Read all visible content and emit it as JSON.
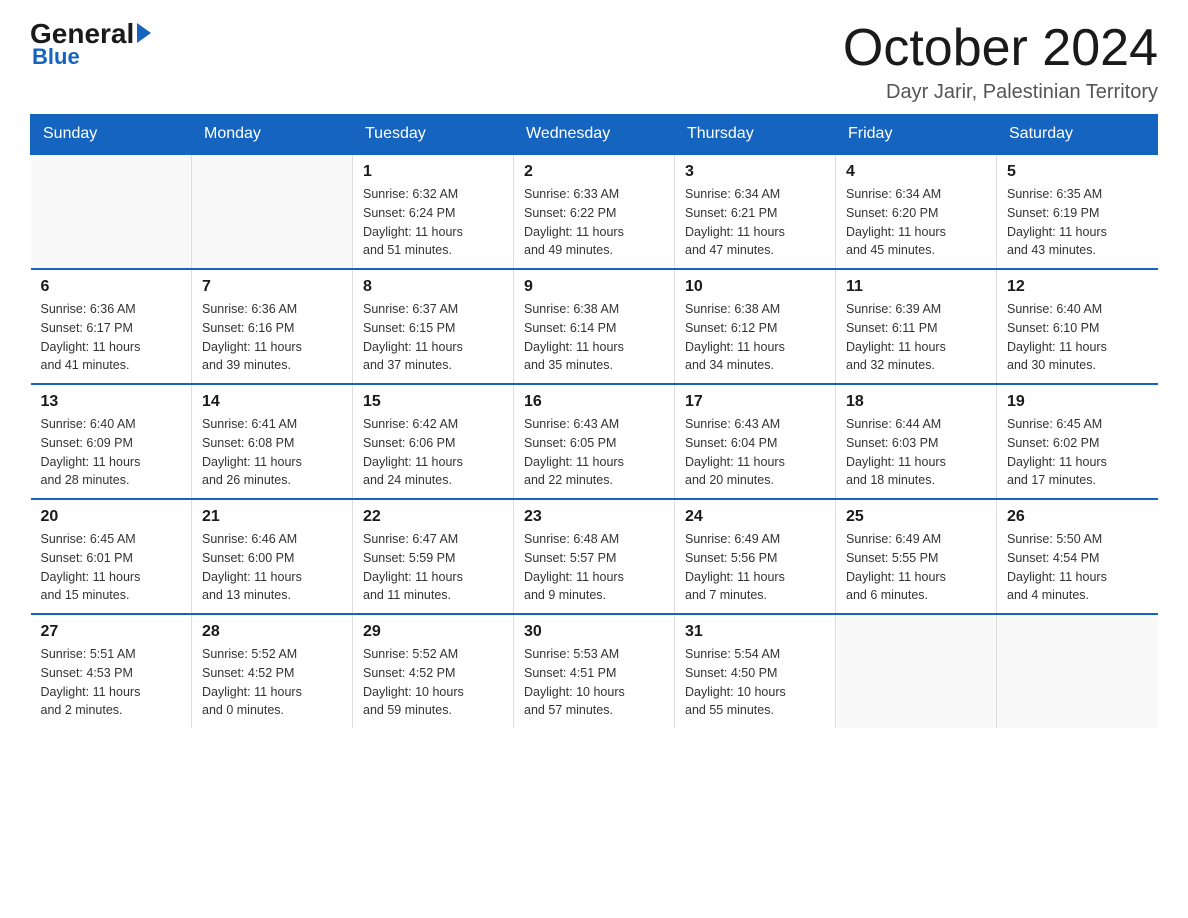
{
  "logo": {
    "general": "General",
    "blue": "Blue",
    "arrow": "▶"
  },
  "title": "October 2024",
  "location": "Dayr Jarir, Palestinian Territory",
  "days_of_week": [
    "Sunday",
    "Monday",
    "Tuesday",
    "Wednesday",
    "Thursday",
    "Friday",
    "Saturday"
  ],
  "weeks": [
    [
      {
        "day": "",
        "info": ""
      },
      {
        "day": "",
        "info": ""
      },
      {
        "day": "1",
        "info": "Sunrise: 6:32 AM\nSunset: 6:24 PM\nDaylight: 11 hours\nand 51 minutes."
      },
      {
        "day": "2",
        "info": "Sunrise: 6:33 AM\nSunset: 6:22 PM\nDaylight: 11 hours\nand 49 minutes."
      },
      {
        "day": "3",
        "info": "Sunrise: 6:34 AM\nSunset: 6:21 PM\nDaylight: 11 hours\nand 47 minutes."
      },
      {
        "day": "4",
        "info": "Sunrise: 6:34 AM\nSunset: 6:20 PM\nDaylight: 11 hours\nand 45 minutes."
      },
      {
        "day": "5",
        "info": "Sunrise: 6:35 AM\nSunset: 6:19 PM\nDaylight: 11 hours\nand 43 minutes."
      }
    ],
    [
      {
        "day": "6",
        "info": "Sunrise: 6:36 AM\nSunset: 6:17 PM\nDaylight: 11 hours\nand 41 minutes."
      },
      {
        "day": "7",
        "info": "Sunrise: 6:36 AM\nSunset: 6:16 PM\nDaylight: 11 hours\nand 39 minutes."
      },
      {
        "day": "8",
        "info": "Sunrise: 6:37 AM\nSunset: 6:15 PM\nDaylight: 11 hours\nand 37 minutes."
      },
      {
        "day": "9",
        "info": "Sunrise: 6:38 AM\nSunset: 6:14 PM\nDaylight: 11 hours\nand 35 minutes."
      },
      {
        "day": "10",
        "info": "Sunrise: 6:38 AM\nSunset: 6:12 PM\nDaylight: 11 hours\nand 34 minutes."
      },
      {
        "day": "11",
        "info": "Sunrise: 6:39 AM\nSunset: 6:11 PM\nDaylight: 11 hours\nand 32 minutes."
      },
      {
        "day": "12",
        "info": "Sunrise: 6:40 AM\nSunset: 6:10 PM\nDaylight: 11 hours\nand 30 minutes."
      }
    ],
    [
      {
        "day": "13",
        "info": "Sunrise: 6:40 AM\nSunset: 6:09 PM\nDaylight: 11 hours\nand 28 minutes."
      },
      {
        "day": "14",
        "info": "Sunrise: 6:41 AM\nSunset: 6:08 PM\nDaylight: 11 hours\nand 26 minutes."
      },
      {
        "day": "15",
        "info": "Sunrise: 6:42 AM\nSunset: 6:06 PM\nDaylight: 11 hours\nand 24 minutes."
      },
      {
        "day": "16",
        "info": "Sunrise: 6:43 AM\nSunset: 6:05 PM\nDaylight: 11 hours\nand 22 minutes."
      },
      {
        "day": "17",
        "info": "Sunrise: 6:43 AM\nSunset: 6:04 PM\nDaylight: 11 hours\nand 20 minutes."
      },
      {
        "day": "18",
        "info": "Sunrise: 6:44 AM\nSunset: 6:03 PM\nDaylight: 11 hours\nand 18 minutes."
      },
      {
        "day": "19",
        "info": "Sunrise: 6:45 AM\nSunset: 6:02 PM\nDaylight: 11 hours\nand 17 minutes."
      }
    ],
    [
      {
        "day": "20",
        "info": "Sunrise: 6:45 AM\nSunset: 6:01 PM\nDaylight: 11 hours\nand 15 minutes."
      },
      {
        "day": "21",
        "info": "Sunrise: 6:46 AM\nSunset: 6:00 PM\nDaylight: 11 hours\nand 13 minutes."
      },
      {
        "day": "22",
        "info": "Sunrise: 6:47 AM\nSunset: 5:59 PM\nDaylight: 11 hours\nand 11 minutes."
      },
      {
        "day": "23",
        "info": "Sunrise: 6:48 AM\nSunset: 5:57 PM\nDaylight: 11 hours\nand 9 minutes."
      },
      {
        "day": "24",
        "info": "Sunrise: 6:49 AM\nSunset: 5:56 PM\nDaylight: 11 hours\nand 7 minutes."
      },
      {
        "day": "25",
        "info": "Sunrise: 6:49 AM\nSunset: 5:55 PM\nDaylight: 11 hours\nand 6 minutes."
      },
      {
        "day": "26",
        "info": "Sunrise: 5:50 AM\nSunset: 4:54 PM\nDaylight: 11 hours\nand 4 minutes."
      }
    ],
    [
      {
        "day": "27",
        "info": "Sunrise: 5:51 AM\nSunset: 4:53 PM\nDaylight: 11 hours\nand 2 minutes."
      },
      {
        "day": "28",
        "info": "Sunrise: 5:52 AM\nSunset: 4:52 PM\nDaylight: 11 hours\nand 0 minutes."
      },
      {
        "day": "29",
        "info": "Sunrise: 5:52 AM\nSunset: 4:52 PM\nDaylight: 10 hours\nand 59 minutes."
      },
      {
        "day": "30",
        "info": "Sunrise: 5:53 AM\nSunset: 4:51 PM\nDaylight: 10 hours\nand 57 minutes."
      },
      {
        "day": "31",
        "info": "Sunrise: 5:54 AM\nSunset: 4:50 PM\nDaylight: 10 hours\nand 55 minutes."
      },
      {
        "day": "",
        "info": ""
      },
      {
        "day": "",
        "info": ""
      }
    ]
  ]
}
